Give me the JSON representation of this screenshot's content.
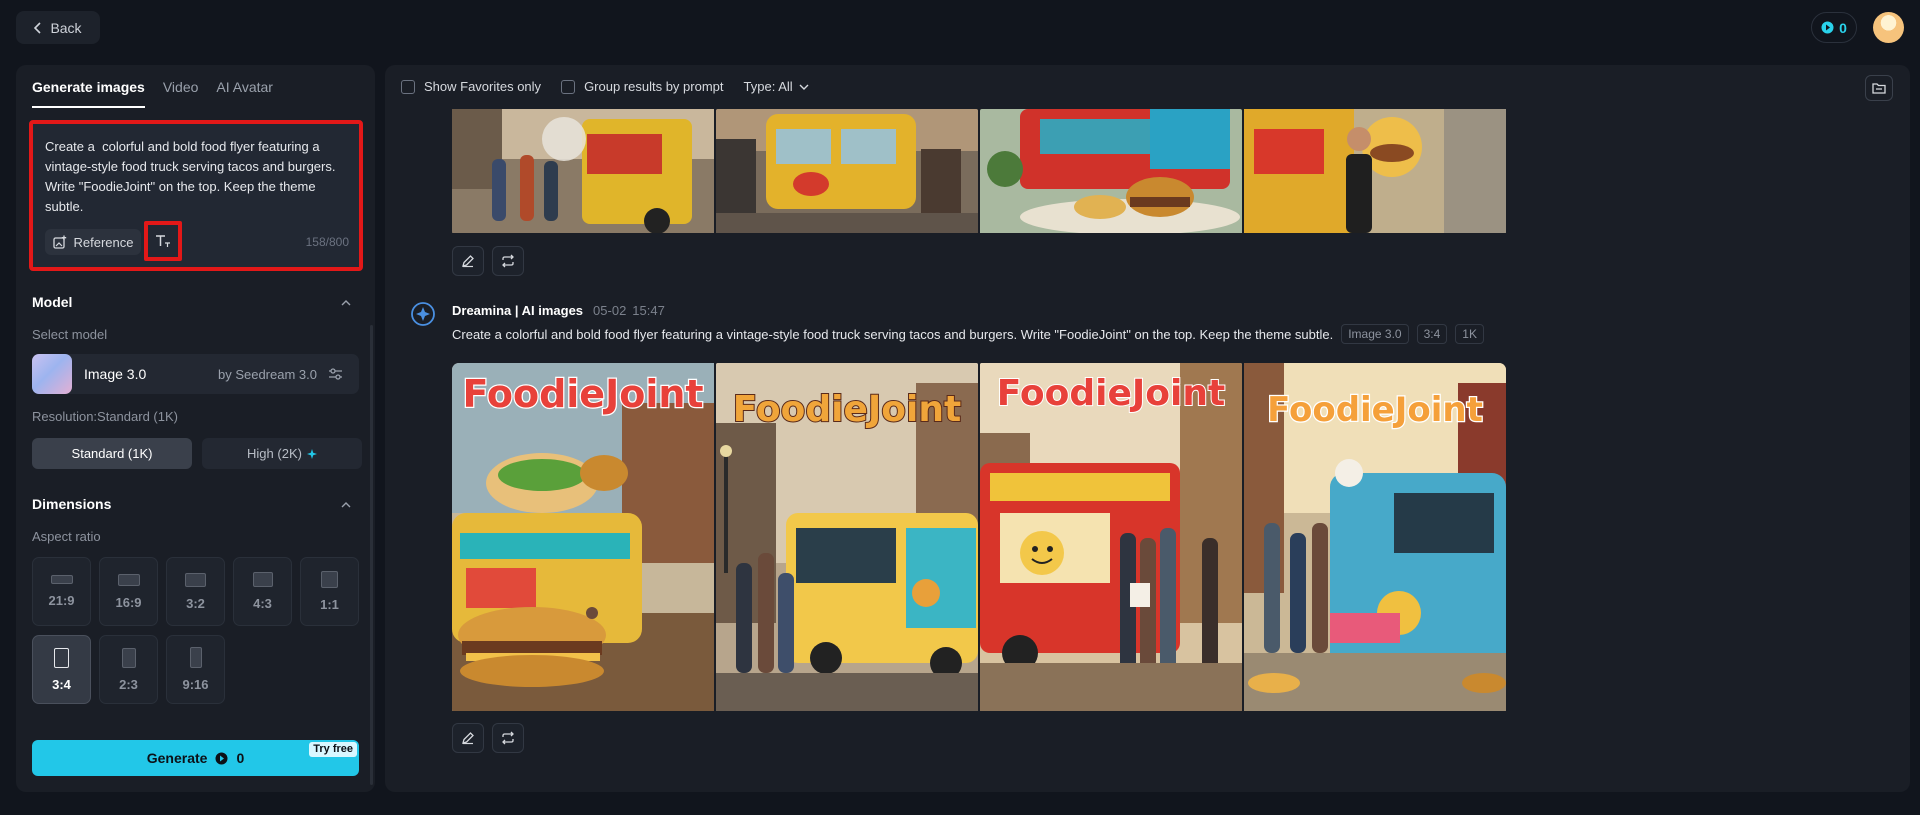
{
  "topbar": {
    "back_label": "Back",
    "credits": "0"
  },
  "sidebar": {
    "tabs": [
      "Generate images",
      "Video",
      "AI Avatar"
    ],
    "prompt": {
      "text": "Create a  colorful and bold food flyer featuring a vintage-style food truck serving tacos and burgers. Write \"FoodieJoint\" on the top. Keep the theme subtle.",
      "reference_label": "Reference",
      "char_count": "158/800"
    },
    "model_section": {
      "title": "Model",
      "select_label": "Select model",
      "model_name": "Image 3.0",
      "model_by": "by Seedream 3.0",
      "resolution_label": "Resolution:Standard (1K)",
      "resolution_options": [
        "Standard (1K)",
        "High (2K)"
      ]
    },
    "dimensions_section": {
      "title": "Dimensions",
      "aspect_label": "Aspect ratio",
      "aspect_ratios": [
        "21:9",
        "16:9",
        "3:2",
        "4:3",
        "1:1",
        "3:4",
        "2:3",
        "9:16"
      ],
      "selected_aspect": "3:4"
    },
    "generate": {
      "label": "Generate",
      "cost": "0",
      "badge": "Try free"
    }
  },
  "main": {
    "filters": {
      "favorites_label": "Show Favorites only",
      "group_label": "Group results by prompt",
      "type_label": "Type: All"
    },
    "generation": {
      "author": "Dreamina | AI images",
      "date": "05-02",
      "time": "15:47",
      "prompt": "Create a colorful and bold food flyer featuring a vintage-style food truck serving tacos and burgers. Write \"FoodieJoint\" on the top. Keep the theme subtle.",
      "tags": [
        "Image 3.0",
        "3:4",
        "1K"
      ],
      "flyer_title": "FoodieJoint"
    }
  },
  "colors": {
    "accent": "#22c7e8",
    "highlight_border": "#e31818",
    "background": "#11151d",
    "panel": "#1a1e26"
  }
}
